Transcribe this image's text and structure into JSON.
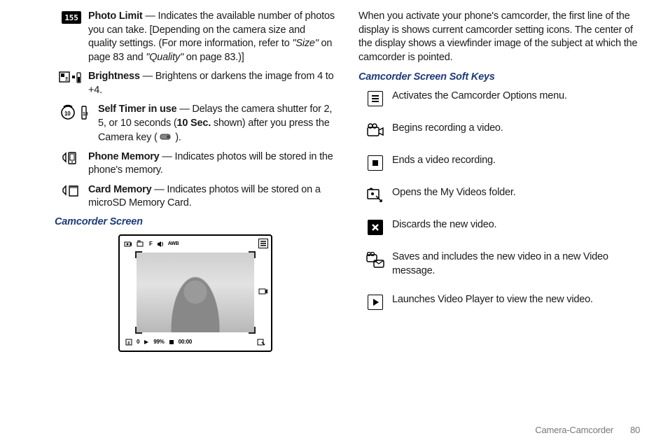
{
  "left": {
    "items": [
      {
        "icon": "photo-limit-icon",
        "title": "Photo Limit",
        "body_1": " — Indicates the available number of photos you can take. [Depending on the camera size and quality settings. (For more information, refer to ",
        "ref1": "\"Size\"",
        "body_2": " on page 83 and ",
        "ref2": "\"Quality\"",
        "body_3": " on page 83.)]"
      },
      {
        "icon": "brightness-icon",
        "title": "Brightness",
        "body": " — Brightens or darkens the image from 4 to +4."
      },
      {
        "icon": "self-timer-icon",
        "title": "Self Timer in use",
        "body_1": " — Delays the camera shutter for 2, 5, or 10 seconds (",
        "bold2": "10 Sec.",
        "body_2": " shown) after you press the Camera key ( ",
        "key_icon": "camera-key-icon",
        "body_3": " )."
      },
      {
        "icon": "phone-memory-icon",
        "title": "Phone Memory",
        "body": " — Indicates photos will be stored in the phone's memory."
      },
      {
        "icon": "card-memory-icon",
        "title": "Card Memory",
        "body": " — Indicates photos will be stored on a microSD Memory Card."
      }
    ],
    "subhead": "Camcorder Screen",
    "viewfinder": {
      "top_icons": [
        "rec-mode",
        "camcorder",
        "F",
        "speaker",
        "AWB"
      ],
      "bottom_left": [
        "ev",
        "0",
        "play",
        "99%",
        "stop",
        "00:00"
      ],
      "bottom_right": "share"
    }
  },
  "right": {
    "intro": "When you activate your phone's camcorder, the first line of the display is shows current camcorder setting icons. The center of the display shows a viewfinder image of the subject at which the camcorder is pointed.",
    "subhead": "Camcorder Screen Soft Keys",
    "keys": [
      {
        "icon": "menu-icon",
        "text": "Activates the Camcorder Options menu."
      },
      {
        "icon": "record-icon",
        "text": "Begins recording a video."
      },
      {
        "icon": "stop-icon",
        "text": "Ends a video recording."
      },
      {
        "icon": "folder-icon",
        "text": "Opens the My Videos folder."
      },
      {
        "icon": "discard-icon",
        "text": "Discards the new video."
      },
      {
        "icon": "attach-video-icon",
        "text": "Saves and includes the new video in a new Video message."
      },
      {
        "icon": "play-icon",
        "text": "Launches Video Player to view the new video."
      }
    ]
  },
  "footer": {
    "section": "Camera-Camcorder",
    "page": "80"
  },
  "counter": "155"
}
